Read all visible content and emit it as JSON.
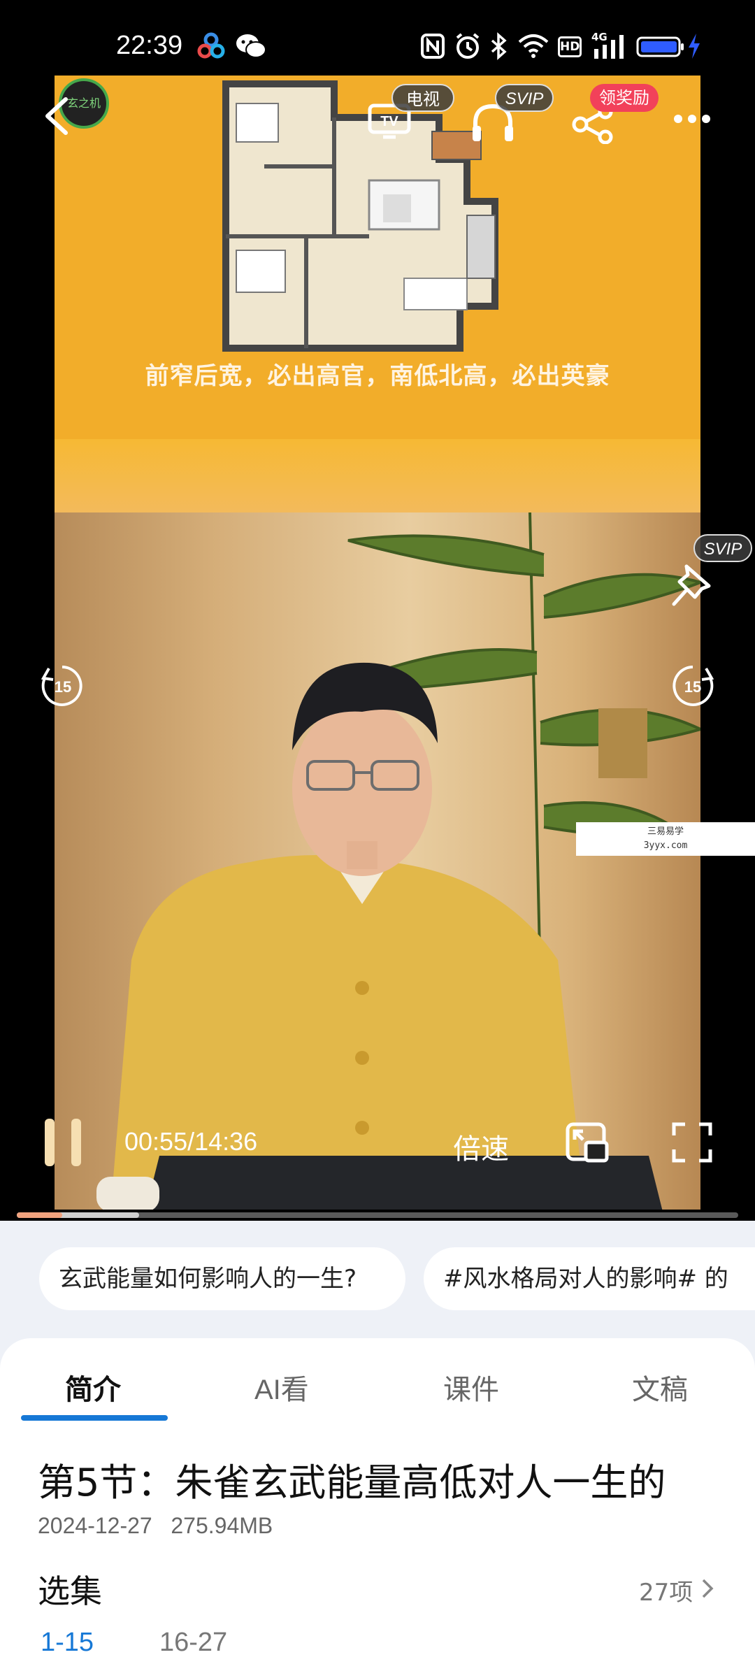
{
  "status_bar": {
    "time": "22:39",
    "network": "4G",
    "hd_label": "HD",
    "icons": [
      "baidu-netdisk-icon",
      "wechat-icon",
      "nfc-icon",
      "alarm-icon",
      "bluetooth-icon",
      "wifi-icon",
      "hd-icon",
      "signal-icon",
      "battery-icon",
      "charging-icon"
    ]
  },
  "video": {
    "caption": "前窄后宽，必出高官，南低北高，必出英豪",
    "watermark_line1": "三易易学",
    "watermark_line2": "3yyx.com",
    "channel_logo_text": "玄之机"
  },
  "top_controls": {
    "tv_label": "电视",
    "audio_badge": "SVIP",
    "share_badge": "领奖励",
    "pin_badge": "SVIP",
    "icons": [
      "back-icon",
      "tv-cast-icon",
      "headphones-icon",
      "share-icon",
      "more-icon",
      "pin-icon"
    ]
  },
  "player": {
    "current_time": "00:55",
    "separator": "/",
    "duration": "14:36",
    "speed_label": "倍速",
    "skip_back_label": "15",
    "skip_forward_label": "15",
    "progress_fraction": 0.063,
    "buffered_fraction": 0.17
  },
  "topics": [
    "玄武能量如何影响人的一生?",
    "#风水格局对人的影响# 的"
  ],
  "tabs": [
    {
      "label": "简介",
      "active": true
    },
    {
      "label": "AI看",
      "active": false
    },
    {
      "label": "课件",
      "active": false
    },
    {
      "label": "文稿",
      "active": false
    }
  ],
  "detail": {
    "title": "第5节：朱雀玄武能量高低对人一生的",
    "date": "2024-12-27",
    "size": "275.94MB"
  },
  "episodes": {
    "label": "选集",
    "count": "27项",
    "ranges": [
      {
        "label": "1-15",
        "active": true
      },
      {
        "label": "16-27",
        "active": false
      }
    ]
  },
  "colors": {
    "accent_blue": "#1678d6",
    "progress": "#f0a27e",
    "badge_red": "#f2415a",
    "floorplan_bg": "#f2ad2a"
  }
}
